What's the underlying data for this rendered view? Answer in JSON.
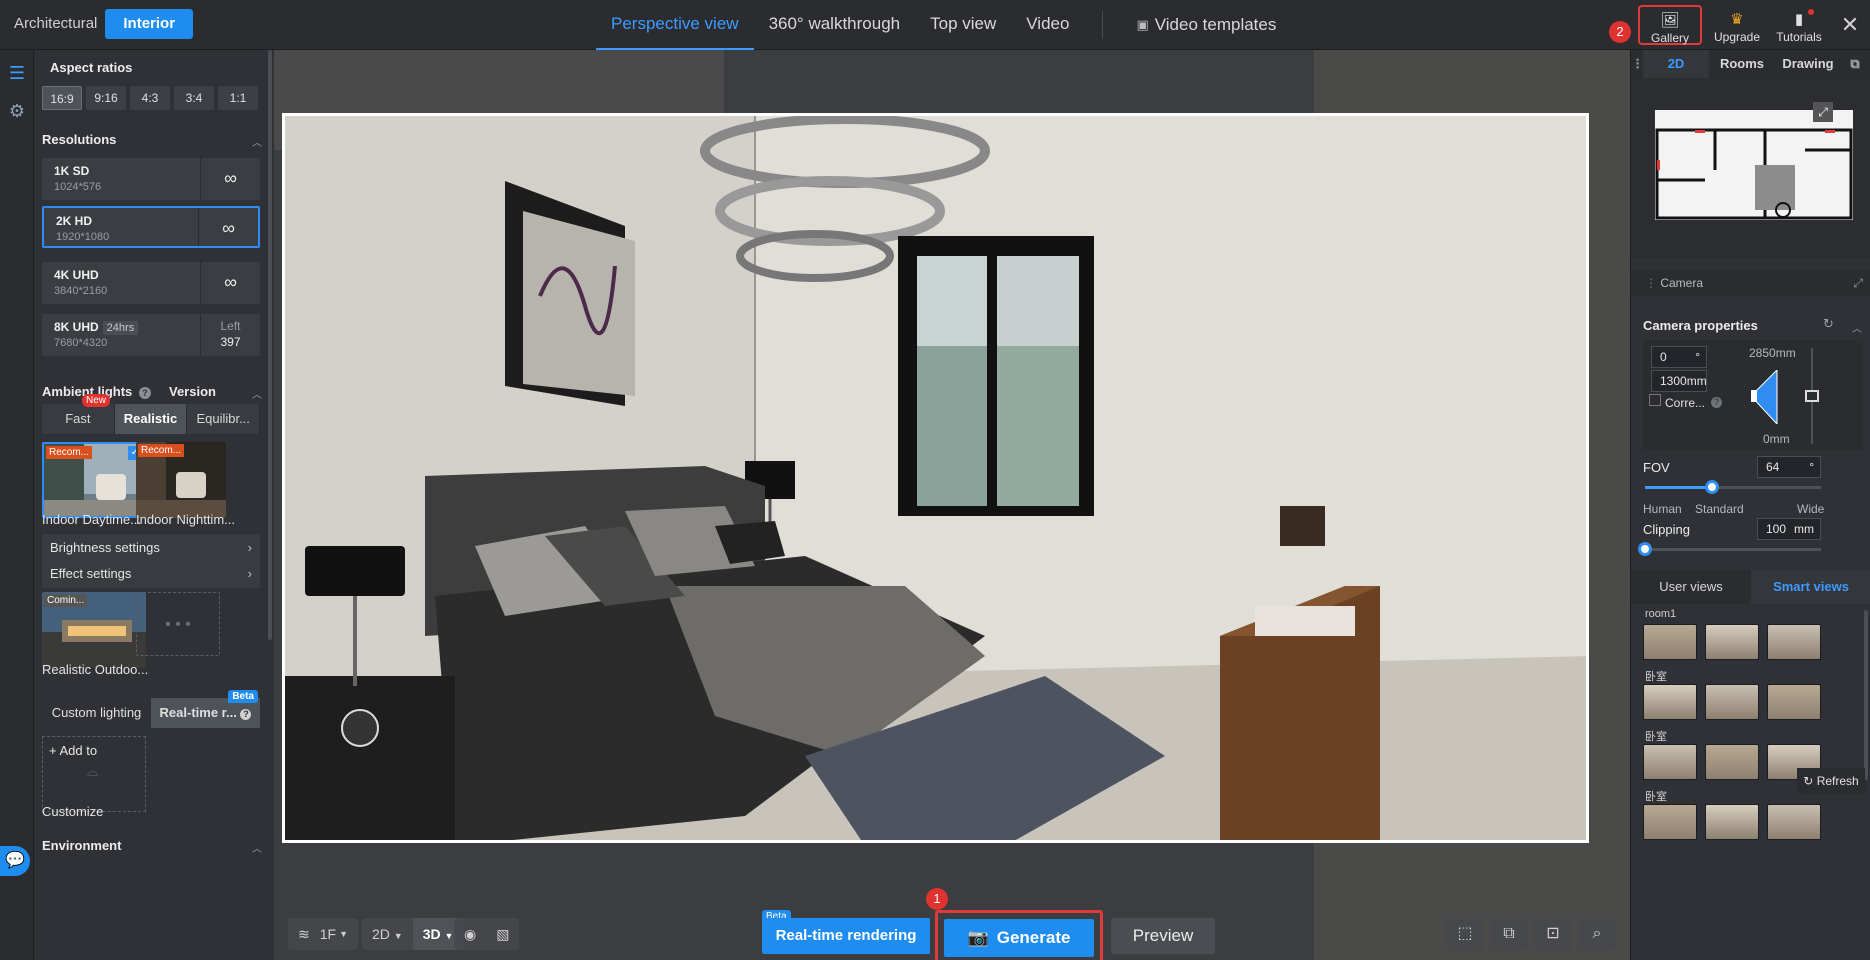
{
  "topbar": {
    "modes": [
      "Architectural",
      "Interior"
    ],
    "views": [
      "Perspective view",
      "360° walkthrough",
      "Top view",
      "Video"
    ],
    "video_templates": "Video templates",
    "badge_2": "2",
    "tools": {
      "gallery": "Gallery",
      "upgrade": "Upgrade",
      "tutorials": "Tutorials"
    }
  },
  "left": {
    "aspect_title": "Aspect ratios",
    "aspects": [
      "16:9",
      "9:16",
      "4:3",
      "3:4",
      "1:1"
    ],
    "res_title": "Resolutions",
    "resolutions": [
      {
        "name": "1K SD",
        "dim": "1024*576",
        "right": "∞"
      },
      {
        "name": "2K HD",
        "dim": "1920*1080",
        "right": "∞"
      },
      {
        "name": "4K UHD",
        "dim": "3840*2160",
        "right": "∞"
      },
      {
        "name": "8K UHD",
        "tag": "24hrs",
        "dim": "7680*4320",
        "left_label": "Left",
        "left_val": "397"
      }
    ],
    "ambient_title": "Ambient lights",
    "version": "Version",
    "new_badge": "New",
    "ambient_modes": [
      "Fast",
      "Realistic",
      "Equilibr..."
    ],
    "recom": "Recom...",
    "presets": [
      "Indoor Daytime...",
      "Indoor Nighttim..."
    ],
    "brightness": "Brightness settings",
    "effect": "Effect settings",
    "coming": "Comin...",
    "outdoor": "Realistic Outdoo...",
    "custom_lighting": "Custom lighting",
    "realtime_short": "Real-time r...",
    "beta": "Beta",
    "add_to": "+ Add to",
    "customize": "Customize",
    "environment": "Environment"
  },
  "bottom": {
    "floor": "1F",
    "mode2d": "2D",
    "mode3d": "3D",
    "beta": "Beta",
    "realtime": "Real-time rendering",
    "generate": "Generate",
    "preview": "Preview",
    "badge_1": "1"
  },
  "right": {
    "tabs": [
      "2D",
      "Rooms",
      "Drawing"
    ],
    "camera": "Camera",
    "cam_props": "Camera properties",
    "angle": "0",
    "angle_unit": "°",
    "height": "1300mm",
    "top_mm": "2850mm",
    "bottom_mm": "0mm",
    "correct": "Corre...",
    "fov_label": "FOV",
    "fov_value": "64",
    "fov_unit": "°",
    "fov_fraction": 0.38,
    "fov_marks": [
      "Human",
      "Standard",
      "Wide"
    ],
    "clipping_label": "Clipping",
    "clipping_value": "100",
    "clipping_unit": "mm",
    "clipping_fraction": 0.0,
    "view_tabs": [
      "User views",
      "Smart views"
    ],
    "groups": [
      "room1",
      "卧室",
      "卧室",
      "卧室"
    ],
    "refresh": "Refresh"
  }
}
